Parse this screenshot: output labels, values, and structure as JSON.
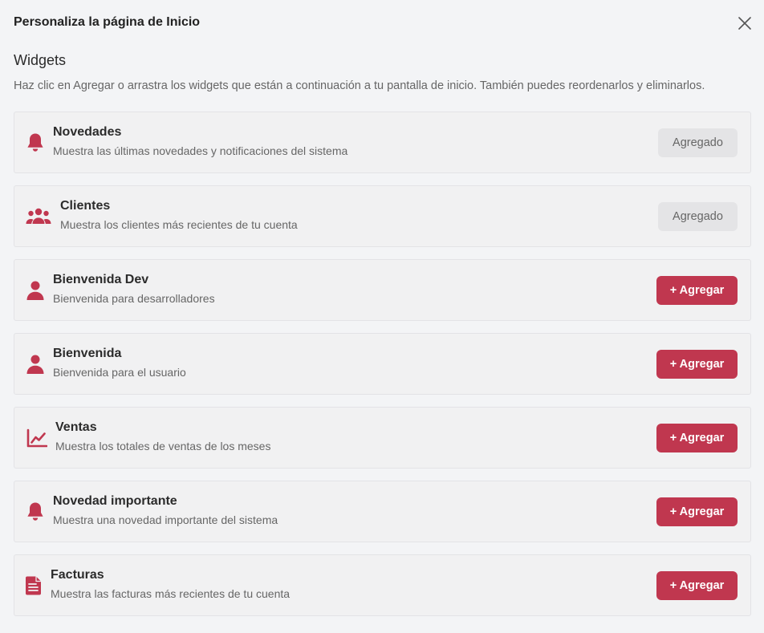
{
  "dialog": {
    "title": "Personaliza la página de Inicio",
    "section_title": "Widgets",
    "section_desc": "Haz clic en Agregar o arrastra los widgets que están a continuación a tu pantalla de inicio. También puedes reordenarlos y eliminarlos."
  },
  "colors": {
    "accent": "#c0374f",
    "added_bg": "#e4e4e6"
  },
  "widgets": [
    {
      "name": "Novedades",
      "desc": "Muestra las últimas novedades y notificaciones del sistema",
      "icon": "bell-icon",
      "status": "added",
      "button": "Agregado"
    },
    {
      "name": "Clientes",
      "desc": "Muestra los clientes más recientes de tu cuenta",
      "icon": "users-icon",
      "status": "added",
      "button": "Agregado"
    },
    {
      "name": "Bienvenida Dev",
      "desc": "Bienvenida para desarrolladores",
      "icon": "user-icon",
      "status": "available",
      "button": "+ Agregar"
    },
    {
      "name": "Bienvenida",
      "desc": "Bienvenida para el usuario",
      "icon": "user-icon",
      "status": "available",
      "button": "+ Agregar"
    },
    {
      "name": "Ventas",
      "desc": "Muestra los totales de ventas de los meses",
      "icon": "chart-line-icon",
      "status": "available",
      "button": "+ Agregar"
    },
    {
      "name": "Novedad importante",
      "desc": "Muestra una novedad importante del sistema",
      "icon": "bell-icon",
      "status": "available",
      "button": "+ Agregar"
    },
    {
      "name": "Facturas",
      "desc": "Muestra las facturas más recientes de tu cuenta",
      "icon": "invoice-icon",
      "status": "available",
      "button": "+ Agregar"
    }
  ]
}
